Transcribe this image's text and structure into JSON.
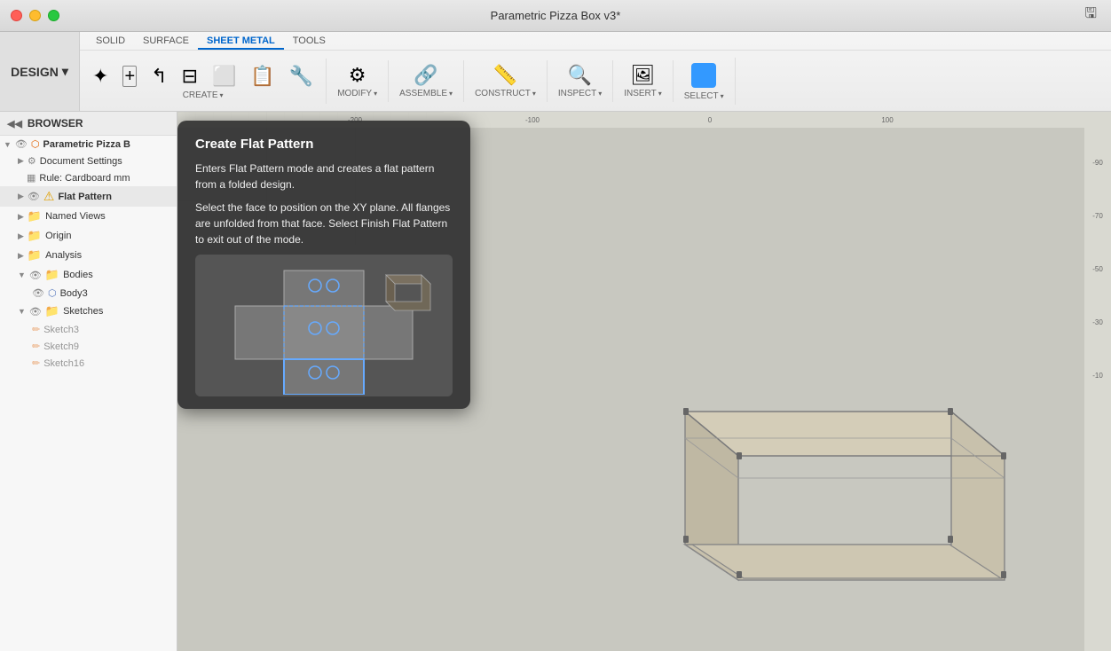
{
  "titlebar": {
    "title": "Parametric Pizza Box v3*"
  },
  "toolbar": {
    "design_label": "DESIGN",
    "design_arrow": "▾",
    "tabs": [
      {
        "label": "SOLID",
        "active": false
      },
      {
        "label": "SURFACE",
        "active": false
      },
      {
        "label": "SHEET METAL",
        "active": true
      },
      {
        "label": "TOOLS",
        "active": false
      }
    ],
    "sections": [
      {
        "name": "CREATE",
        "has_arrow": true,
        "tools": [
          {
            "icon": "⭐",
            "label": ""
          },
          {
            "icon": "📄",
            "label": ""
          },
          {
            "icon": "↩",
            "label": ""
          },
          {
            "icon": "⬜",
            "label": ""
          },
          {
            "icon": "🔵",
            "label": ""
          },
          {
            "icon": "📐",
            "label": ""
          },
          {
            "icon": "🔧",
            "label": ""
          }
        ]
      },
      {
        "name": "MODIFY",
        "has_arrow": true,
        "tools": []
      },
      {
        "name": "ASSEMBLE",
        "has_arrow": true,
        "tools": []
      },
      {
        "name": "CONSTRUCT",
        "has_arrow": true,
        "tools": [
          {
            "icon": "📏",
            "label": ""
          }
        ]
      },
      {
        "name": "INSPECT",
        "has_arrow": true,
        "tools": [
          {
            "icon": "📏",
            "label": ""
          }
        ]
      },
      {
        "name": "INSERT",
        "has_arrow": true,
        "tools": [
          {
            "icon": "🖼",
            "label": ""
          }
        ]
      },
      {
        "name": "SELECT",
        "has_arrow": true,
        "tools": [
          {
            "icon": "◻",
            "label": ""
          }
        ]
      }
    ]
  },
  "sidebar": {
    "header": "BROWSER",
    "items": [
      {
        "label": "Parametric Pizza B",
        "type": "root",
        "indent": 0,
        "expanded": true,
        "has_eye": true
      },
      {
        "label": "Document Settings",
        "type": "settings",
        "indent": 1,
        "expanded": false,
        "has_eye": false
      },
      {
        "label": "Rule: Cardboard mm",
        "type": "rule",
        "indent": 1,
        "expanded": false,
        "has_eye": false
      },
      {
        "label": "Flat Pattern",
        "type": "flat",
        "indent": 1,
        "expanded": false,
        "has_eye": true
      },
      {
        "label": "Named Views",
        "type": "folder",
        "indent": 1,
        "expanded": false,
        "has_eye": false
      },
      {
        "label": "Origin",
        "type": "folder",
        "indent": 1,
        "expanded": false,
        "has_eye": false
      },
      {
        "label": "Analysis",
        "type": "folder",
        "indent": 1,
        "expanded": false,
        "has_eye": false
      },
      {
        "label": "Bodies",
        "type": "folder",
        "indent": 1,
        "expanded": true,
        "has_eye": true
      },
      {
        "label": "Body3",
        "type": "body",
        "indent": 2,
        "expanded": false,
        "has_eye": true
      },
      {
        "label": "Sketches",
        "type": "folder",
        "indent": 1,
        "expanded": true,
        "has_eye": true
      },
      {
        "label": "Sketch3",
        "type": "sketch",
        "indent": 2,
        "expanded": false,
        "has_eye": false
      },
      {
        "label": "Sketch9",
        "type": "sketch",
        "indent": 2,
        "expanded": false,
        "has_eye": false
      },
      {
        "label": "Sketch16",
        "type": "sketch",
        "indent": 2,
        "expanded": false,
        "has_eye": false
      }
    ]
  },
  "tooltip": {
    "title": "Create Flat Pattern",
    "desc1": "Enters Flat Pattern mode and creates a flat pattern from a folded design.",
    "desc2": "Select the face to position on the XY plane. All flanges are unfolded from that face. Select Finish Flat Pattern to exit out of the mode."
  },
  "canvas": {
    "bg_color": "#c8c8bc"
  }
}
